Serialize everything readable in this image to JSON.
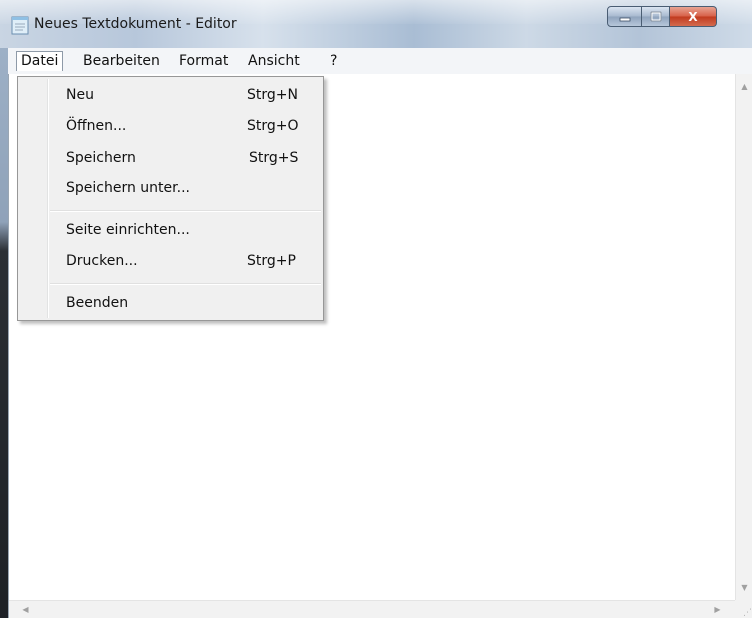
{
  "window": {
    "title": "Neues Textdokument - Editor"
  },
  "caption_buttons": {
    "minimize_icon": "minimize-icon",
    "maximize_icon": "maximize-icon",
    "close_icon": "close-icon",
    "close_symbol": "X"
  },
  "menubar": {
    "items": [
      {
        "label": "Datei",
        "active": true
      },
      {
        "label": "Bearbeiten"
      },
      {
        "label": "Format"
      },
      {
        "label": "Ansicht"
      },
      {
        "label": "?"
      }
    ]
  },
  "file_menu": {
    "items": [
      {
        "label": "Neu",
        "shortcut": "Strg+N"
      },
      {
        "label": "Öffnen...",
        "shortcut": "Strg+O"
      },
      {
        "label": "Speichern",
        "shortcut": "Strg+S"
      },
      {
        "label": "Speichern unter...",
        "shortcut": ""
      },
      {
        "label": "Seite einrichten...",
        "shortcut": ""
      },
      {
        "label": "Drucken...",
        "shortcut": "Strg+P"
      },
      {
        "label": "Beenden",
        "shortcut": ""
      }
    ]
  },
  "editor": {
    "content": ""
  },
  "colors": {
    "menu_background": "#f0f0f0",
    "menubar_background": "#f3f5f8",
    "close_button": "#c13a1f"
  }
}
